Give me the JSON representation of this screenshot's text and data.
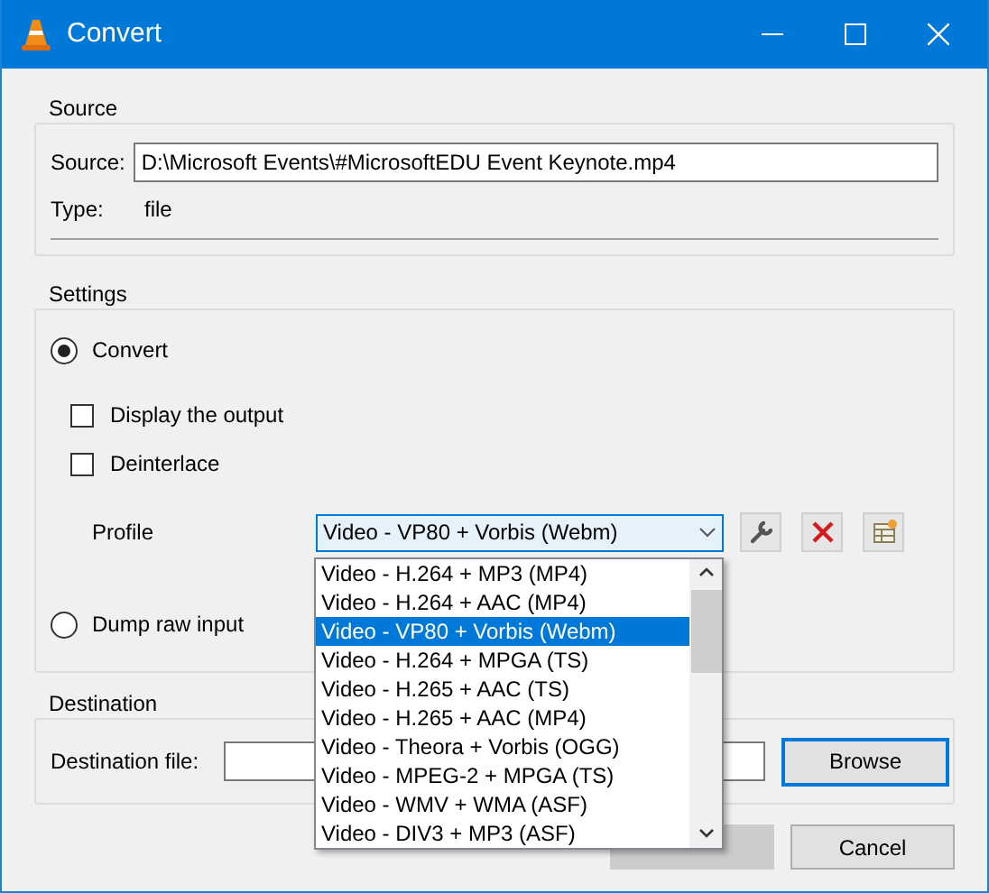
{
  "window": {
    "title": "Convert"
  },
  "source": {
    "group_label": "Source",
    "source_label": "Source:",
    "value": "D:\\Microsoft Events\\#MicrosoftEDU Event Keynote.mp4",
    "type_label": "Type:",
    "type_value": "file"
  },
  "settings": {
    "group_label": "Settings",
    "convert": {
      "label": "Convert",
      "selected": true
    },
    "options": [
      {
        "label": "Display the output",
        "checked": false
      },
      {
        "label": "Deinterlace",
        "checked": false
      }
    ],
    "profile": {
      "label": "Profile",
      "value": "Video - VP80 + Vorbis (Webm)",
      "expanded": true,
      "items": [
        {
          "label": "Video - H.264 + MP3 (MP4)",
          "selected": false
        },
        {
          "label": "Video - H.264 + AAC (MP4)",
          "selected": false
        },
        {
          "label": "Video - VP80 + Vorbis (Webm)",
          "selected": true
        },
        {
          "label": "Video - H.264 + MPGA (TS)",
          "selected": false
        },
        {
          "label": "Video - H.265 + AAC (TS)",
          "selected": false
        },
        {
          "label": "Video - H.265 + AAC (MP4)",
          "selected": false
        },
        {
          "label": "Video - Theora + Vorbis (OGG)",
          "selected": false
        },
        {
          "label": "Video - MPEG-2 + MPGA (TS)",
          "selected": false
        },
        {
          "label": "Video - WMV + WMA (ASF)",
          "selected": false
        },
        {
          "label": "Video - DIV3 + MP3 (ASF)",
          "selected": false
        }
      ]
    },
    "dump": {
      "label": "Dump raw input",
      "selected": false
    }
  },
  "destination": {
    "group_label": "Destination",
    "file_label": "Destination file:",
    "browse": "Browse"
  },
  "buttons": [
    {
      "disabled": true
    },
    {
      "label": "Cancel",
      "disabled": false
    }
  ]
}
